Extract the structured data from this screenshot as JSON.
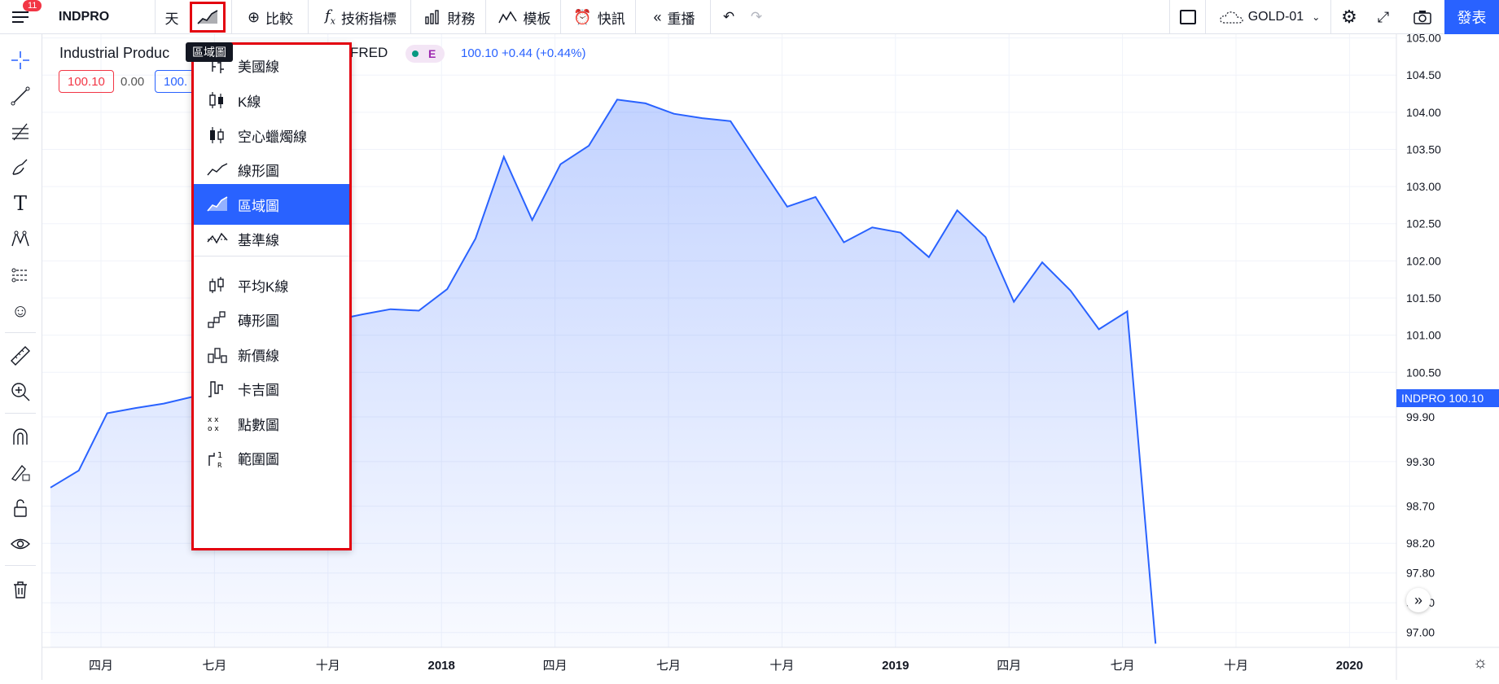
{
  "topbar": {
    "symbol": "INDPRO",
    "badge": "11",
    "interval": "天",
    "compare": "比較",
    "indicators": "技術指標",
    "financials": "財務",
    "templates": "模板",
    "alert": "快訊",
    "replay": "重播",
    "layout_name": "GOLD-01",
    "publish": "發表"
  },
  "tooltip": "區域圖",
  "legend": {
    "title": "Industrial Produc",
    "source": "FRED",
    "badge": "E",
    "value": "100.10 +0.44 (+0.44%)",
    "open": "100.10",
    "change": "0.00",
    "close": "100."
  },
  "chart_type_menu": {
    "items": [
      {
        "label": "美國線",
        "icon": "bars-icon"
      },
      {
        "label": "K線",
        "icon": "candles-icon"
      },
      {
        "label": "空心蠟燭線",
        "icon": "hollow-candles-icon"
      },
      {
        "label": "線形圖",
        "icon": "line-icon"
      },
      {
        "label": "區域圖",
        "icon": "area-icon",
        "selected": true
      },
      {
        "label": "基準線",
        "icon": "baseline-icon"
      },
      {
        "label": "平均K線",
        "icon": "heikin-ashi-icon"
      },
      {
        "label": "磚形圖",
        "icon": "renko-icon"
      },
      {
        "label": "新價線",
        "icon": "line-break-icon"
      },
      {
        "label": "卡吉圖",
        "icon": "kagi-icon"
      },
      {
        "label": "點數圖",
        "icon": "point-figure-icon"
      },
      {
        "label": "範圍圖",
        "icon": "range-icon"
      }
    ]
  },
  "price_tag": "INDPRO  100.10",
  "colors": {
    "accent": "#2962ff",
    "menu_border": "#e3000f",
    "down": "#f23645"
  },
  "chart_data": {
    "type": "area",
    "series": [
      {
        "name": "INDPRO",
        "values": [
          98.95,
          99.18,
          99.95,
          100.02,
          100.08,
          100.17,
          100.13,
          100.2,
          100.4,
          100.85,
          101.2,
          101.28,
          101.35,
          101.33,
          101.62,
          102.3,
          103.4,
          102.55,
          103.3,
          103.55,
          104.17,
          104.12,
          103.98,
          103.92,
          103.88,
          103.3,
          102.73,
          102.86,
          102.25,
          102.45,
          102.38,
          102.05,
          102.68,
          102.32,
          101.45,
          101.98,
          101.6,
          101.08,
          101.32,
          96.85
        ]
      }
    ],
    "x_tick_labels": [
      "四月",
      "七月",
      "十月",
      "2018",
      "四月",
      "七月",
      "十月",
      "2019",
      "四月",
      "七月",
      "十月",
      "2020"
    ],
    "y_tick_labels": [
      "97.00",
      "97.40",
      "97.80",
      "98.20",
      "98.70",
      "99.30",
      "99.90",
      "100.50",
      "101.00",
      "101.50",
      "102.00",
      "102.50",
      "103.00",
      "103.50",
      "104.00",
      "104.50",
      "105.00"
    ],
    "ylim": [
      96.8,
      105.05
    ],
    "grid": true
  }
}
